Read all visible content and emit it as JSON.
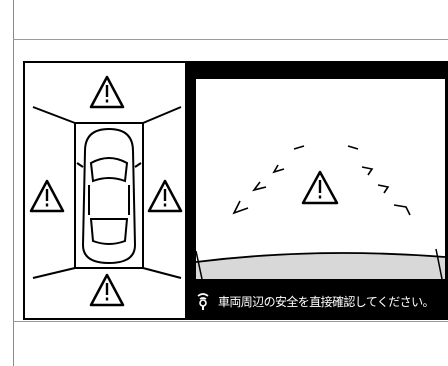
{
  "screen": {
    "message": "車両周辺の安全を直接確認してください。",
    "panels": {
      "left": "panoramic-top-view",
      "right": "front-camera-view"
    },
    "icons": {
      "warning": "warning-triangle-icon",
      "sensor": "sensor-icon"
    }
  }
}
